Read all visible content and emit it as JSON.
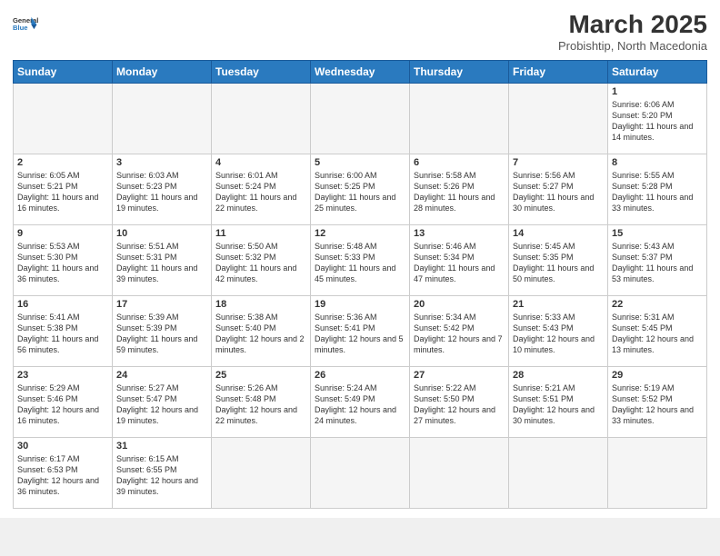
{
  "header": {
    "logo_general": "General",
    "logo_blue": "Blue",
    "title": "March 2025",
    "subtitle": "Probishtip, North Macedonia"
  },
  "weekdays": [
    "Sunday",
    "Monday",
    "Tuesday",
    "Wednesday",
    "Thursday",
    "Friday",
    "Saturday"
  ],
  "weeks": [
    [
      {
        "day": "",
        "info": "",
        "empty": true
      },
      {
        "day": "",
        "info": "",
        "empty": true
      },
      {
        "day": "",
        "info": "",
        "empty": true
      },
      {
        "day": "",
        "info": "",
        "empty": true
      },
      {
        "day": "",
        "info": "",
        "empty": true
      },
      {
        "day": "",
        "info": "",
        "empty": true
      },
      {
        "day": "1",
        "info": "Sunrise: 6:06 AM\nSunset: 5:20 PM\nDaylight: 11 hours and 14 minutes.",
        "empty": false
      }
    ],
    [
      {
        "day": "2",
        "info": "Sunrise: 6:05 AM\nSunset: 5:21 PM\nDaylight: 11 hours and 16 minutes.",
        "empty": false
      },
      {
        "day": "3",
        "info": "Sunrise: 6:03 AM\nSunset: 5:23 PM\nDaylight: 11 hours and 19 minutes.",
        "empty": false
      },
      {
        "day": "4",
        "info": "Sunrise: 6:01 AM\nSunset: 5:24 PM\nDaylight: 11 hours and 22 minutes.",
        "empty": false
      },
      {
        "day": "5",
        "info": "Sunrise: 6:00 AM\nSunset: 5:25 PM\nDaylight: 11 hours and 25 minutes.",
        "empty": false
      },
      {
        "day": "6",
        "info": "Sunrise: 5:58 AM\nSunset: 5:26 PM\nDaylight: 11 hours and 28 minutes.",
        "empty": false
      },
      {
        "day": "7",
        "info": "Sunrise: 5:56 AM\nSunset: 5:27 PM\nDaylight: 11 hours and 30 minutes.",
        "empty": false
      },
      {
        "day": "8",
        "info": "Sunrise: 5:55 AM\nSunset: 5:28 PM\nDaylight: 11 hours and 33 minutes.",
        "empty": false
      }
    ],
    [
      {
        "day": "9",
        "info": "Sunrise: 5:53 AM\nSunset: 5:30 PM\nDaylight: 11 hours and 36 minutes.",
        "empty": false
      },
      {
        "day": "10",
        "info": "Sunrise: 5:51 AM\nSunset: 5:31 PM\nDaylight: 11 hours and 39 minutes.",
        "empty": false
      },
      {
        "day": "11",
        "info": "Sunrise: 5:50 AM\nSunset: 5:32 PM\nDaylight: 11 hours and 42 minutes.",
        "empty": false
      },
      {
        "day": "12",
        "info": "Sunrise: 5:48 AM\nSunset: 5:33 PM\nDaylight: 11 hours and 45 minutes.",
        "empty": false
      },
      {
        "day": "13",
        "info": "Sunrise: 5:46 AM\nSunset: 5:34 PM\nDaylight: 11 hours and 47 minutes.",
        "empty": false
      },
      {
        "day": "14",
        "info": "Sunrise: 5:45 AM\nSunset: 5:35 PM\nDaylight: 11 hours and 50 minutes.",
        "empty": false
      },
      {
        "day": "15",
        "info": "Sunrise: 5:43 AM\nSunset: 5:37 PM\nDaylight: 11 hours and 53 minutes.",
        "empty": false
      }
    ],
    [
      {
        "day": "16",
        "info": "Sunrise: 5:41 AM\nSunset: 5:38 PM\nDaylight: 11 hours and 56 minutes.",
        "empty": false
      },
      {
        "day": "17",
        "info": "Sunrise: 5:39 AM\nSunset: 5:39 PM\nDaylight: 11 hours and 59 minutes.",
        "empty": false
      },
      {
        "day": "18",
        "info": "Sunrise: 5:38 AM\nSunset: 5:40 PM\nDaylight: 12 hours and 2 minutes.",
        "empty": false
      },
      {
        "day": "19",
        "info": "Sunrise: 5:36 AM\nSunset: 5:41 PM\nDaylight: 12 hours and 5 minutes.",
        "empty": false
      },
      {
        "day": "20",
        "info": "Sunrise: 5:34 AM\nSunset: 5:42 PM\nDaylight: 12 hours and 7 minutes.",
        "empty": false
      },
      {
        "day": "21",
        "info": "Sunrise: 5:33 AM\nSunset: 5:43 PM\nDaylight: 12 hours and 10 minutes.",
        "empty": false
      },
      {
        "day": "22",
        "info": "Sunrise: 5:31 AM\nSunset: 5:45 PM\nDaylight: 12 hours and 13 minutes.",
        "empty": false
      }
    ],
    [
      {
        "day": "23",
        "info": "Sunrise: 5:29 AM\nSunset: 5:46 PM\nDaylight: 12 hours and 16 minutes.",
        "empty": false
      },
      {
        "day": "24",
        "info": "Sunrise: 5:27 AM\nSunset: 5:47 PM\nDaylight: 12 hours and 19 minutes.",
        "empty": false
      },
      {
        "day": "25",
        "info": "Sunrise: 5:26 AM\nSunset: 5:48 PM\nDaylight: 12 hours and 22 minutes.",
        "empty": false
      },
      {
        "day": "26",
        "info": "Sunrise: 5:24 AM\nSunset: 5:49 PM\nDaylight: 12 hours and 24 minutes.",
        "empty": false
      },
      {
        "day": "27",
        "info": "Sunrise: 5:22 AM\nSunset: 5:50 PM\nDaylight: 12 hours and 27 minutes.",
        "empty": false
      },
      {
        "day": "28",
        "info": "Sunrise: 5:21 AM\nSunset: 5:51 PM\nDaylight: 12 hours and 30 minutes.",
        "empty": false
      },
      {
        "day": "29",
        "info": "Sunrise: 5:19 AM\nSunset: 5:52 PM\nDaylight: 12 hours and 33 minutes.",
        "empty": false
      }
    ],
    [
      {
        "day": "30",
        "info": "Sunrise: 6:17 AM\nSunset: 6:53 PM\nDaylight: 12 hours and 36 minutes.",
        "empty": false
      },
      {
        "day": "31",
        "info": "Sunrise: 6:15 AM\nSunset: 6:55 PM\nDaylight: 12 hours and 39 minutes.",
        "empty": false
      },
      {
        "day": "",
        "info": "",
        "empty": true
      },
      {
        "day": "",
        "info": "",
        "empty": true
      },
      {
        "day": "",
        "info": "",
        "empty": true
      },
      {
        "day": "",
        "info": "",
        "empty": true
      },
      {
        "day": "",
        "info": "",
        "empty": true
      }
    ]
  ]
}
